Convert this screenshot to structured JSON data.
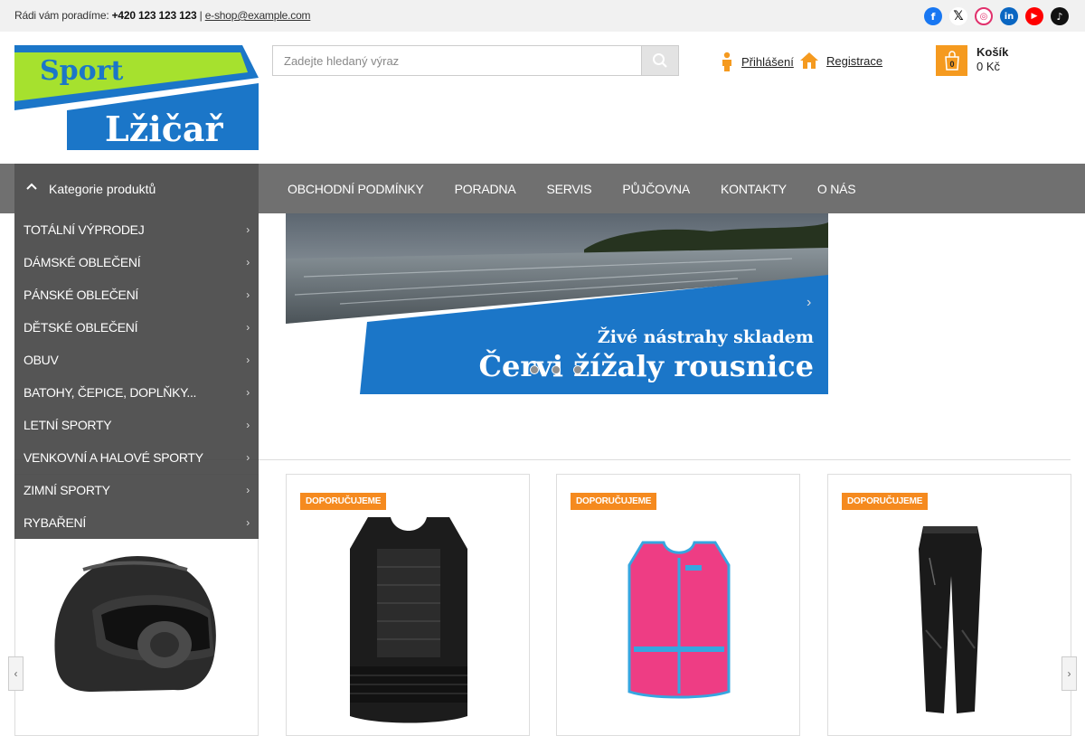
{
  "topbar": {
    "contact_prefix": "Rádi vám poradíme:",
    "phone": "+420 123 123 123",
    "separator": "|",
    "email": "e-shop@example.com"
  },
  "socials": [
    {
      "name": "facebook-icon",
      "color": "#1877f2",
      "glyph": "f"
    },
    {
      "name": "x-icon",
      "color": "#ffffff",
      "glyph": "X"
    },
    {
      "name": "instagram-icon",
      "color": "#e1306c",
      "glyph": "◎"
    },
    {
      "name": "linkedin-icon",
      "color": "#0a66c2",
      "glyph": "in"
    },
    {
      "name": "youtube-icon",
      "color": "#ff0000",
      "glyph": "▶"
    },
    {
      "name": "tiktok-icon",
      "color": "#111111",
      "glyph": "♪"
    }
  ],
  "logo": {
    "line1": "Sport",
    "line2": "Lžičař",
    "green": "#a6e12e",
    "blue": "#1b76c8"
  },
  "search": {
    "placeholder": "Zadejte hledaný výraz"
  },
  "account": {
    "login": "Přihlášení",
    "register": "Registrace"
  },
  "cart": {
    "title": "Košík",
    "total": "0 Kč",
    "count": "0"
  },
  "nav": {
    "category_head": "Kategorie produktů",
    "links": [
      "OBCHODNÍ PODMÍNKY",
      "PORADNA",
      "SERVIS",
      "PŮJČOVNA",
      "KONTAKTY",
      "O NÁS"
    ]
  },
  "categories": [
    "TOTÁLNÍ VÝPRODEJ",
    "DÁMSKÉ OBLEČENÍ",
    "PÁNSKÉ OBLEČENÍ",
    "DĚTSKÉ OBLEČENÍ",
    "OBUV",
    "BATOHY, ČEPICE, DOPLŇKY...",
    "LETNÍ SPORTY",
    "VENKOVNÍ A HALOVÉ SPORTY",
    "ZIMNÍ SPORTY",
    "RYBAŘENÍ"
  ],
  "banner": {
    "line1": "Živé nástrahy skladem",
    "line2": "Červi  žížaly  rousnice",
    "active_slide": 1
  },
  "products": [
    {
      "badge": ""
    },
    {
      "badge": "DOPORUČUJEME"
    },
    {
      "badge": "DOPORUČUJEME"
    },
    {
      "badge": "DOPORUČUJEME"
    }
  ],
  "colors": {
    "accent": "#f59a1f",
    "nav": "#707070",
    "logo_blue": "#1b76c8",
    "logo_green": "#a6e12e"
  }
}
